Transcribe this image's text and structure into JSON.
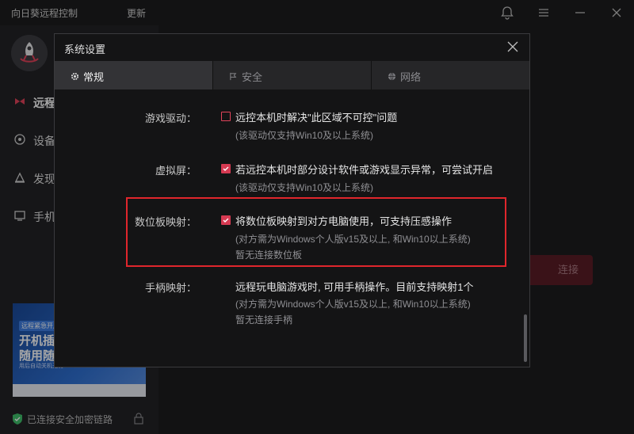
{
  "app": {
    "title": "向日葵远程控制",
    "update": "更新"
  },
  "sidebar": {
    "items": [
      {
        "label": "远程",
        "icon": "remote-icon",
        "active": true
      },
      {
        "label": "设备",
        "icon": "device-icon"
      },
      {
        "label": "发现",
        "icon": "discover-icon"
      },
      {
        "label": "手机",
        "icon": "phone-icon"
      }
    ],
    "promo": {
      "tag": "远程紧急开启",
      "line1": "开机插座",
      "line2": "随用随开",
      "sub": "用后自动关机无需..."
    },
    "security_text": "已连接安全加密链路"
  },
  "main": {
    "connect_label": "连接"
  },
  "dialog": {
    "title": "系统设置",
    "tabs": [
      {
        "label": "常规",
        "icon": "gear-icon",
        "active": true
      },
      {
        "label": "安全",
        "icon": "flag-icon"
      },
      {
        "label": "网络",
        "icon": "globe-icon"
      }
    ],
    "settings": [
      {
        "label": "游戏驱动：",
        "checked": false,
        "text": "远控本机时解决\"此区域不可控\"问题",
        "notes": [
          "(该驱动仅支持Win10及以上系统)"
        ]
      },
      {
        "label": "虚拟屏：",
        "checked": true,
        "text": "若远控本机时部分设计软件或游戏显示异常，可尝试开启",
        "notes": [
          "(该驱动仅支持Win10及以上系统)"
        ]
      },
      {
        "label": "数位板映射：",
        "checked": true,
        "text": "将数位板映射到对方电脑使用，可支持压感操作",
        "notes": [
          "(对方需为Windows个人版v15及以上, 和Win10以上系统)",
          "暂无连接数位板"
        ]
      },
      {
        "label": "手柄映射：",
        "checked": null,
        "text": "远程玩电脑游戏时, 可用手柄操作。目前支持映射1个",
        "notes": [
          "(对方需为Windows个人版v15及以上, 和Win10以上系统)",
          "暂无连接手柄"
        ]
      }
    ]
  },
  "colors": {
    "accent": "#d63a52",
    "highlight_border": "#e0262c",
    "shield": "#3fbf6b"
  }
}
